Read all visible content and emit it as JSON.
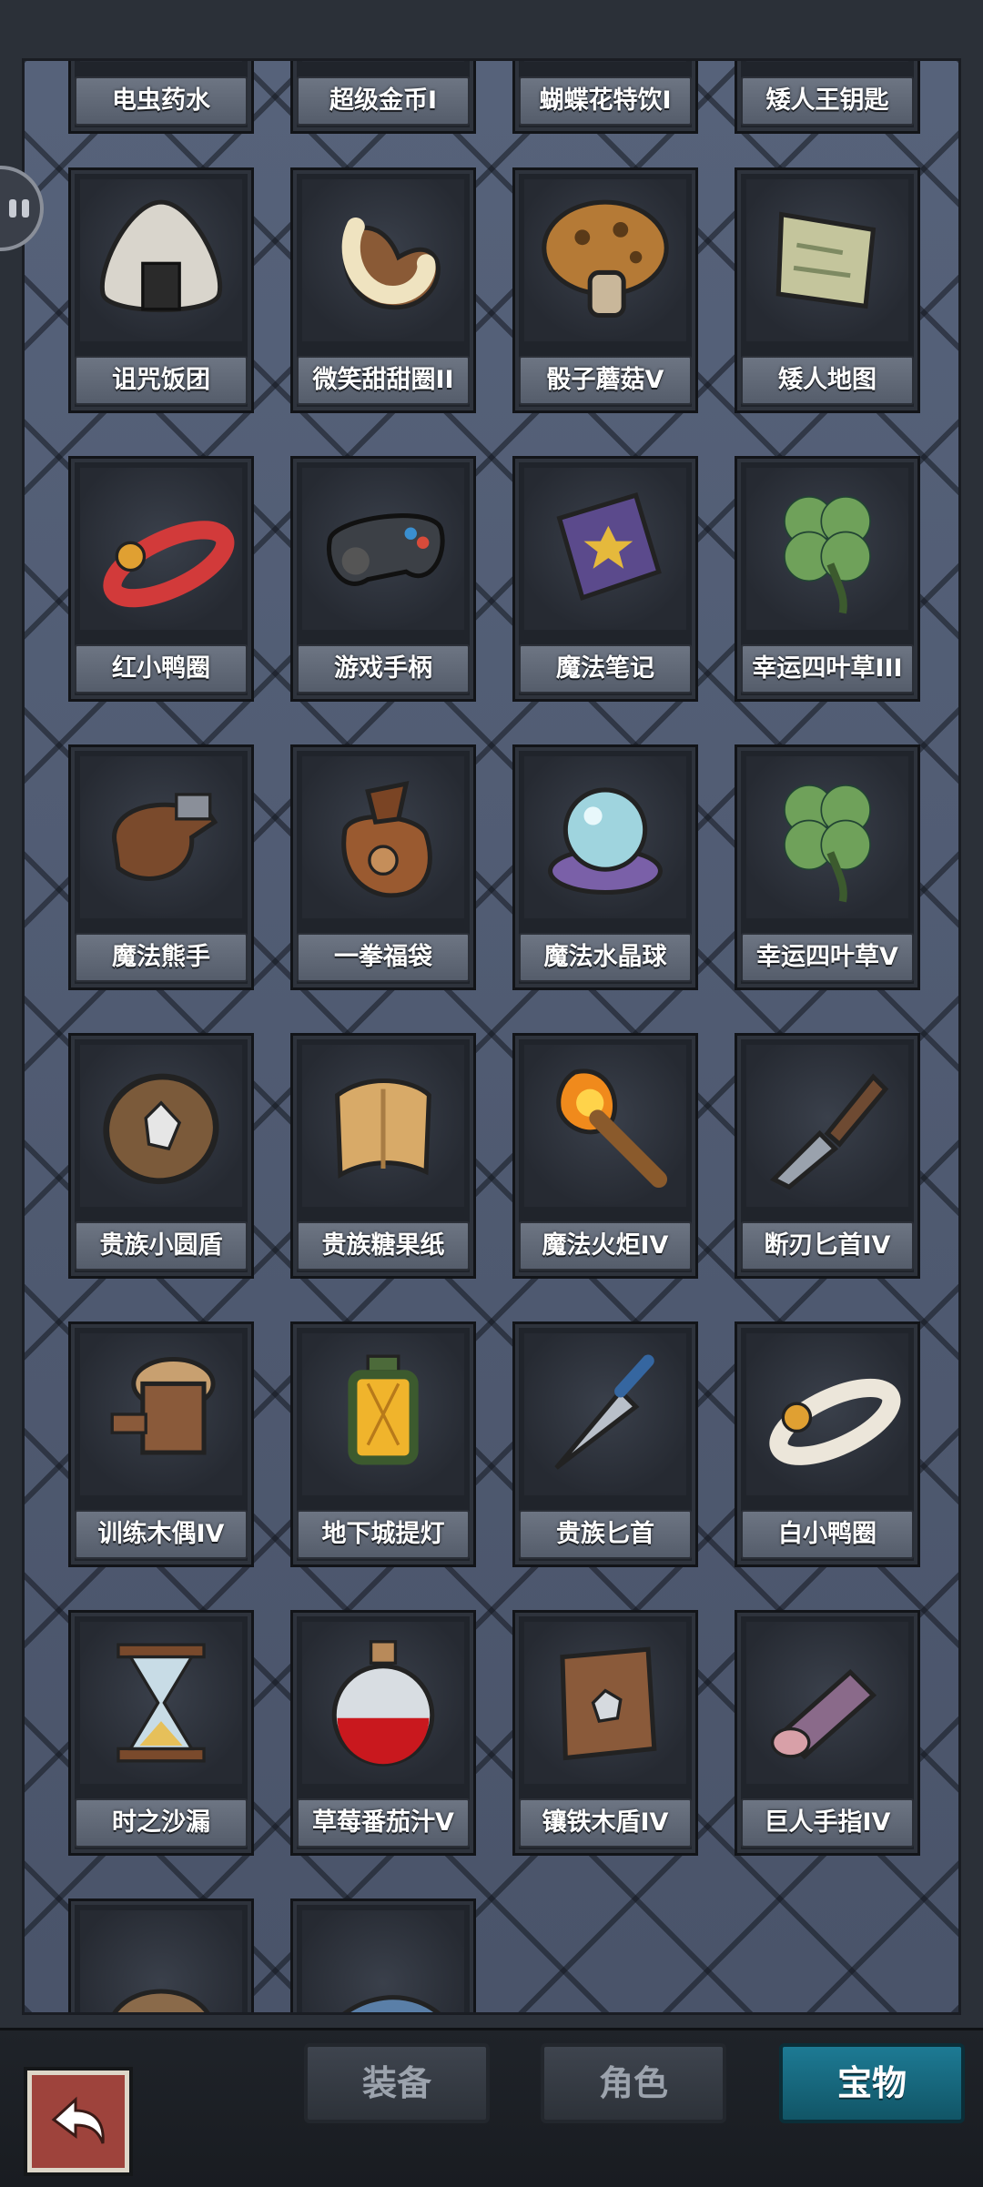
{
  "items": [
    {
      "name": "电虫药水",
      "icon": "potion-icon"
    },
    {
      "name": "超级金币I",
      "icon": "coin-icon"
    },
    {
      "name": "蝴蝶花特饮I",
      "icon": "drink-icon"
    },
    {
      "name": "矮人王钥匙",
      "icon": "key-icon"
    },
    {
      "name": "诅咒饭团",
      "icon": "rice-ball-icon"
    },
    {
      "name": "微笑甜甜圈II",
      "icon": "donut-icon"
    },
    {
      "name": "骰子蘑菇V",
      "icon": "mushroom-icon"
    },
    {
      "name": "矮人地图",
      "icon": "map-scroll-icon"
    },
    {
      "name": "红小鸭圈",
      "icon": "red-duck-ring-icon"
    },
    {
      "name": "游戏手柄",
      "icon": "gamepad-icon"
    },
    {
      "name": "魔法笔记",
      "icon": "spellbook-icon"
    },
    {
      "name": "幸运四叶草III",
      "icon": "clover-icon"
    },
    {
      "name": "魔法熊手",
      "icon": "bear-paw-icon"
    },
    {
      "name": "一拳福袋",
      "icon": "fist-bag-icon"
    },
    {
      "name": "魔法水晶球",
      "icon": "crystal-ball-icon"
    },
    {
      "name": "幸运四叶草V",
      "icon": "clover-icon"
    },
    {
      "name": "贵族小圆盾",
      "icon": "round-shield-icon"
    },
    {
      "name": "贵族糖果纸",
      "icon": "candy-paper-icon"
    },
    {
      "name": "魔法火炬IV",
      "icon": "torch-icon"
    },
    {
      "name": "断刃匕首IV",
      "icon": "broken-dagger-icon"
    },
    {
      "name": "训练木偶IV",
      "icon": "wooden-dummy-icon"
    },
    {
      "name": "地下城提灯",
      "icon": "lantern-icon"
    },
    {
      "name": "贵族匕首",
      "icon": "dagger-icon"
    },
    {
      "name": "白小鸭圈",
      "icon": "white-duck-ring-icon"
    },
    {
      "name": "时之沙漏",
      "icon": "hourglass-icon"
    },
    {
      "name": "草莓番茄汁V",
      "icon": "red-potion-icon"
    },
    {
      "name": "镶铁木盾IV",
      "icon": "wooden-shield-icon"
    },
    {
      "name": "巨人手指IV",
      "icon": "giant-finger-icon"
    },
    {
      "name": "",
      "icon": "helmet-icon"
    },
    {
      "name": "",
      "icon": "shark-icon"
    }
  ],
  "tabs": {
    "equipment": "装备",
    "character": "角色",
    "treasure": "宝物"
  },
  "active_tab": "treasure",
  "colors": {
    "panel_bg": "#4b566c",
    "active_tab": "#1d7a94",
    "back_button": "#9e433c"
  }
}
